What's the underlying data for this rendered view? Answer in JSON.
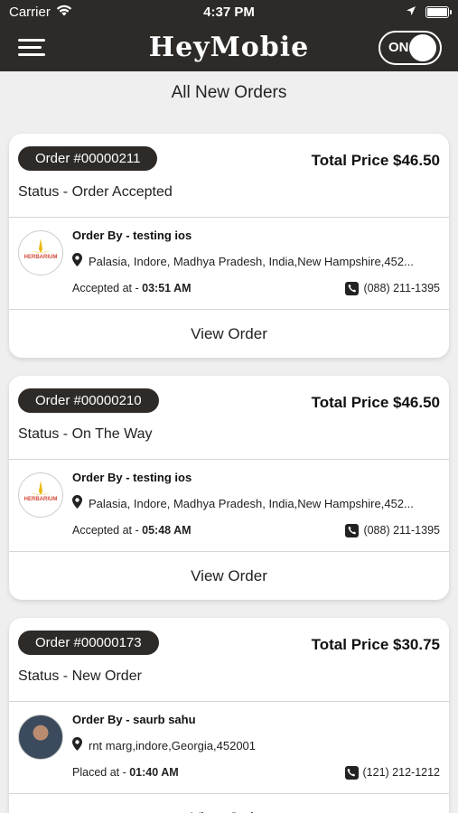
{
  "status_bar": {
    "carrier": "Carrier",
    "time": "4:37 PM"
  },
  "nav": {
    "brand": "HeyMobie",
    "toggle_label": "ON"
  },
  "page_title": "All New Orders",
  "orders": [
    {
      "order_number": "Order #00000211",
      "total_price": "Total Price $46.50",
      "status": "Status - Order Accepted",
      "order_by": "Order By - testing ios",
      "address": "Palasia, Indore, Madhya Pradesh, India,New Hampshire,452...",
      "time_label": "Accepted at - ",
      "time_value": "03:51 AM",
      "phone": "(088) 211-1395",
      "action": "View Order",
      "avatar": "herbarium-logo"
    },
    {
      "order_number": "Order #00000210",
      "total_price": "Total Price $46.50",
      "status": "Status - On The Way",
      "order_by": "Order By - testing ios",
      "address": "Palasia, Indore, Madhya Pradesh, India,New Hampshire,452...",
      "time_label": "Accepted at - ",
      "time_value": "05:48 AM",
      "phone": "(088) 211-1395",
      "action": "View Order",
      "avatar": "herbarium-logo"
    },
    {
      "order_number": "Order #00000173",
      "total_price": "Total Price $30.75",
      "status": "Status - New Order",
      "order_by": "Order By - saurb sahu",
      "address": "rnt marg,indore,Georgia,452001",
      "time_label": "Placed at - ",
      "time_value": "01:40 AM",
      "phone": "(121) 212-1212",
      "action": "View Order",
      "avatar": "user-photo"
    }
  ],
  "colors": {
    "header_bg": "#2d2a28",
    "page_bg": "#efefef",
    "card_bg": "#ffffff",
    "pill_bg": "#2d2a28",
    "logo_accent": "#e8b800"
  }
}
